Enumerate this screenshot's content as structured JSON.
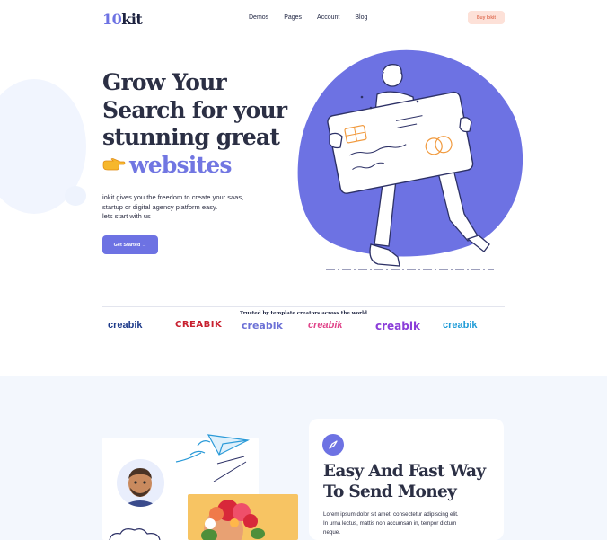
{
  "nav": {
    "logo_prefix": "10",
    "logo_suffix": "kit",
    "links": [
      "Demos",
      "Pages",
      "Account",
      "Blog"
    ],
    "buy_label": "Buy Iokit"
  },
  "hero": {
    "title_line1": "Grow Your",
    "title_line2": "Search for your",
    "title_line3": "stunning great",
    "title_line4": "websites",
    "desc_line1": "iokit gives you the freedom to create your saas,",
    "desc_line2": "startup or digital agency platform easy.",
    "desc_line3": "lets start with us",
    "cta_label": "Get Started →"
  },
  "trusted": {
    "label": "Trusted by template creators across the world",
    "brands": [
      {
        "name": "creabik",
        "color": "#1d3a8a"
      },
      {
        "name": "CREABIK",
        "color": "#c8202f"
      },
      {
        "name": "creabik",
        "color": "#6c71d6"
      },
      {
        "name": "creabik",
        "color": "#e0458a"
      },
      {
        "name": "creabik",
        "color": "#8b3dd9"
      },
      {
        "name": "creabik",
        "color": "#1e9bd7"
      }
    ]
  },
  "section2": {
    "title_line1": "Easy And Fast Way",
    "title_line2": "To Send Money",
    "desc_line1": "Lorem ipsum dolor sit amet, consectetur adipiscing elit.",
    "desc_line2": "In urna lectus, mattis non accumsan in, tempor dictum",
    "desc_line3": "neque."
  },
  "icons": {
    "compass": "compass-icon",
    "hand": "pointing-hand-icon",
    "paper_plane": "paper-plane-icon"
  },
  "colors": {
    "accent": "#6d72e3",
    "heading": "#2b2f44",
    "buy_bg": "#fde1d8",
    "buy_text": "#e0735a",
    "section_bg": "#f3f7fd"
  }
}
